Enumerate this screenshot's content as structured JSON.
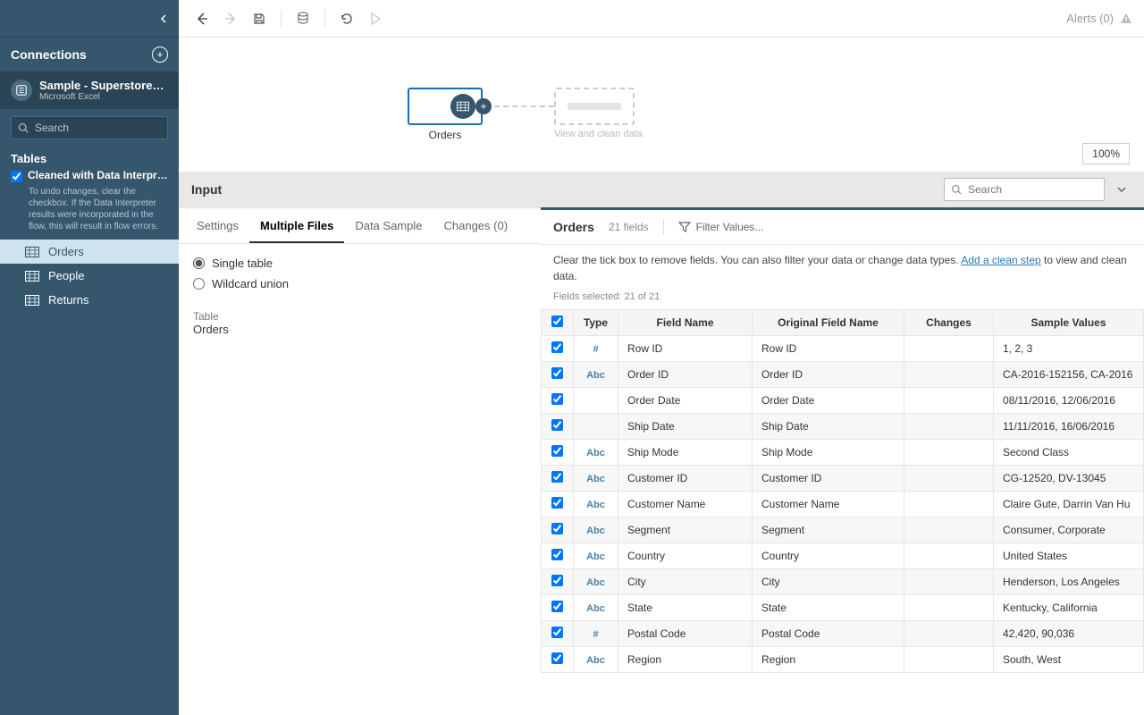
{
  "toolbar": {
    "alerts": "Alerts (0)"
  },
  "sidebar": {
    "connections_label": "Connections",
    "conn_name": "Sample - Superstore....",
    "conn_type": "Microsoft Excel",
    "search_placeholder": "Search",
    "tables_label": "Tables",
    "interp_title": "Cleaned with Data Interpre...",
    "interp_note": "To undo changes, clear the checkbox. If the Data Interpreter results were incorporated in the flow, this will result in flow errors.",
    "tables": [
      {
        "label": "Orders"
      },
      {
        "label": "People"
      },
      {
        "label": "Returns"
      }
    ]
  },
  "flow": {
    "node_label": "Orders",
    "ghost_label": "View and clean data",
    "zoom": "100%"
  },
  "input_pane": {
    "label": "Input",
    "tabs": {
      "settings": "Settings",
      "multiple_files": "Multiple Files",
      "data_sample": "Data Sample",
      "changes": "Changes (0)"
    },
    "radios": {
      "single": "Single table",
      "wildcard": "Wildcard union"
    },
    "table_lbl": "Table",
    "table_val": "Orders"
  },
  "orders": {
    "search_placeholder": "Search",
    "title": "Orders",
    "field_count": "21 fields",
    "filter_label": "Filter Values...",
    "hint_prefix": "Clear the tick box to remove fields. You can also filter your data or change data types. ",
    "hint_link": "Add a clean step",
    "hint_suffix": " to view and clean data.",
    "fields_selected": "Fields selected: 21 of 21",
    "headers": {
      "type": "Type",
      "field_name": "Field Name",
      "original": "Original Field Name",
      "changes": "Changes",
      "sample": "Sample Values"
    },
    "rows": [
      {
        "type": "num",
        "name": "Row ID",
        "orig": "Row ID",
        "changes": "",
        "sample": "1, 2, 3"
      },
      {
        "type": "abc",
        "name": "Order ID",
        "orig": "Order ID",
        "changes": "",
        "sample": "CA-2016-152156, CA-2016"
      },
      {
        "type": "date",
        "name": "Order Date",
        "orig": "Order Date",
        "changes": "",
        "sample": "08/11/2016, 12/06/2016"
      },
      {
        "type": "date",
        "name": "Ship Date",
        "orig": "Ship Date",
        "changes": "",
        "sample": "11/11/2016, 16/06/2016"
      },
      {
        "type": "abc",
        "name": "Ship Mode",
        "orig": "Ship Mode",
        "changes": "",
        "sample": "Second Class"
      },
      {
        "type": "abc",
        "name": "Customer ID",
        "orig": "Customer ID",
        "changes": "",
        "sample": "CG-12520, DV-13045"
      },
      {
        "type": "abc",
        "name": "Customer Name",
        "orig": "Customer Name",
        "changes": "",
        "sample": "Claire Gute, Darrin Van Hu"
      },
      {
        "type": "abc",
        "name": "Segment",
        "orig": "Segment",
        "changes": "",
        "sample": "Consumer, Corporate"
      },
      {
        "type": "abc",
        "name": "Country",
        "orig": "Country",
        "changes": "",
        "sample": "United States"
      },
      {
        "type": "abc",
        "name": "City",
        "orig": "City",
        "changes": "",
        "sample": "Henderson, Los Angeles"
      },
      {
        "type": "abc",
        "name": "State",
        "orig": "State",
        "changes": "",
        "sample": "Kentucky, California"
      },
      {
        "type": "num",
        "name": "Postal Code",
        "orig": "Postal Code",
        "changes": "",
        "sample": "42,420, 90,036"
      },
      {
        "type": "abc",
        "name": "Region",
        "orig": "Region",
        "changes": "",
        "sample": "South, West"
      }
    ]
  }
}
